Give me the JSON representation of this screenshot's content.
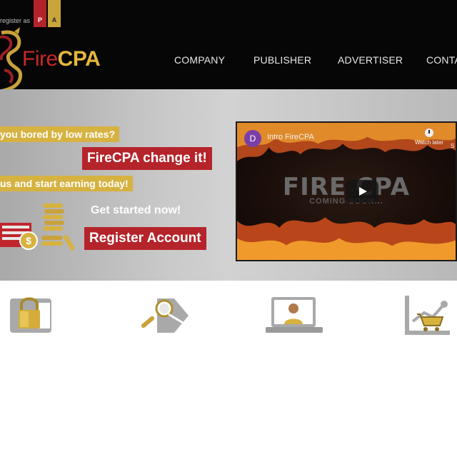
{
  "header": {
    "register_text": "register as",
    "register_p": "P",
    "register_a": "A",
    "logo_fire": "Fire",
    "logo_cpa": "CPA",
    "nav": [
      "COMPANY",
      "PUBLISHER",
      "ADVERTISER",
      "CONTA"
    ]
  },
  "hero": {
    "tagline1": "you bored by low rates?",
    "tagline2": "FireCPA change it!",
    "tagline3": "us and start earning today!",
    "get_started": "Get started now!",
    "register_button": "Register Account"
  },
  "video": {
    "channel_initial": "D",
    "title": "Intro FireCPA",
    "watch_later": "Watch later",
    "share": "S",
    "big_text": "FIRE CPA",
    "sub_text": "COMING SOON..."
  },
  "features": {
    "icons": [
      "lock-icon",
      "search-tag-icon",
      "user-laptop-icon",
      "cart-chart-icon"
    ]
  },
  "colors": {
    "brand_red": "#b5242a",
    "brand_gold": "#d6b241",
    "header_bg": "#060606"
  }
}
